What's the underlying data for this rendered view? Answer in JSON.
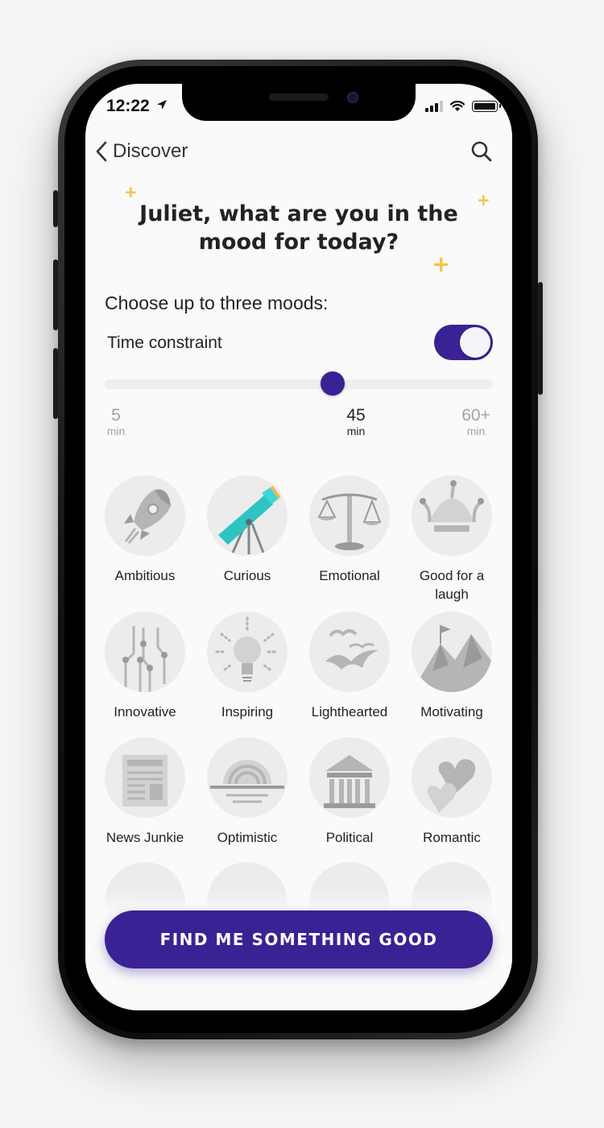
{
  "status_bar": {
    "time": "12:22"
  },
  "nav": {
    "back_label": "Discover"
  },
  "prompt": {
    "headline_line1": "Juliet, what are you in the",
    "headline_line2": "mood for today?",
    "subhead": "Choose up to three moods:"
  },
  "time_constraint": {
    "label": "Time constraint",
    "enabled": true,
    "slider_value_fraction": 0.6,
    "ticks": [
      {
        "value": "5",
        "unit": "min",
        "state": "dim"
      },
      {
        "value": "45",
        "unit": "min",
        "state": "active"
      },
      {
        "value": "60+",
        "unit": "min",
        "state": "dim"
      }
    ]
  },
  "moods": [
    {
      "label": "Ambitious",
      "icon": "rocket-icon"
    },
    {
      "label": "Curious",
      "icon": "telescope-icon"
    },
    {
      "label": "Emotional",
      "icon": "scales-icon"
    },
    {
      "label": "Good for a laugh",
      "icon": "jester-hat-icon"
    },
    {
      "label": "Innovative",
      "icon": "circuit-icon"
    },
    {
      "label": "Inspiring",
      "icon": "lightbulb-icon"
    },
    {
      "label": "Lighthearted",
      "icon": "birds-icon"
    },
    {
      "label": "Motivating",
      "icon": "mountain-icon"
    },
    {
      "label": "News Junkie",
      "icon": "newspaper-icon"
    },
    {
      "label": "Optimistic",
      "icon": "sunrise-icon"
    },
    {
      "label": "Political",
      "icon": "capitol-icon"
    },
    {
      "label": "Romantic",
      "icon": "hearts-icon"
    }
  ],
  "cta": {
    "label": "FIND ME SOMETHING GOOD"
  },
  "colors": {
    "accent": "#3a2294",
    "sparkle": "#f6c344",
    "teal": "#2ec4c4",
    "icon_gray": "#b5b5b5"
  }
}
